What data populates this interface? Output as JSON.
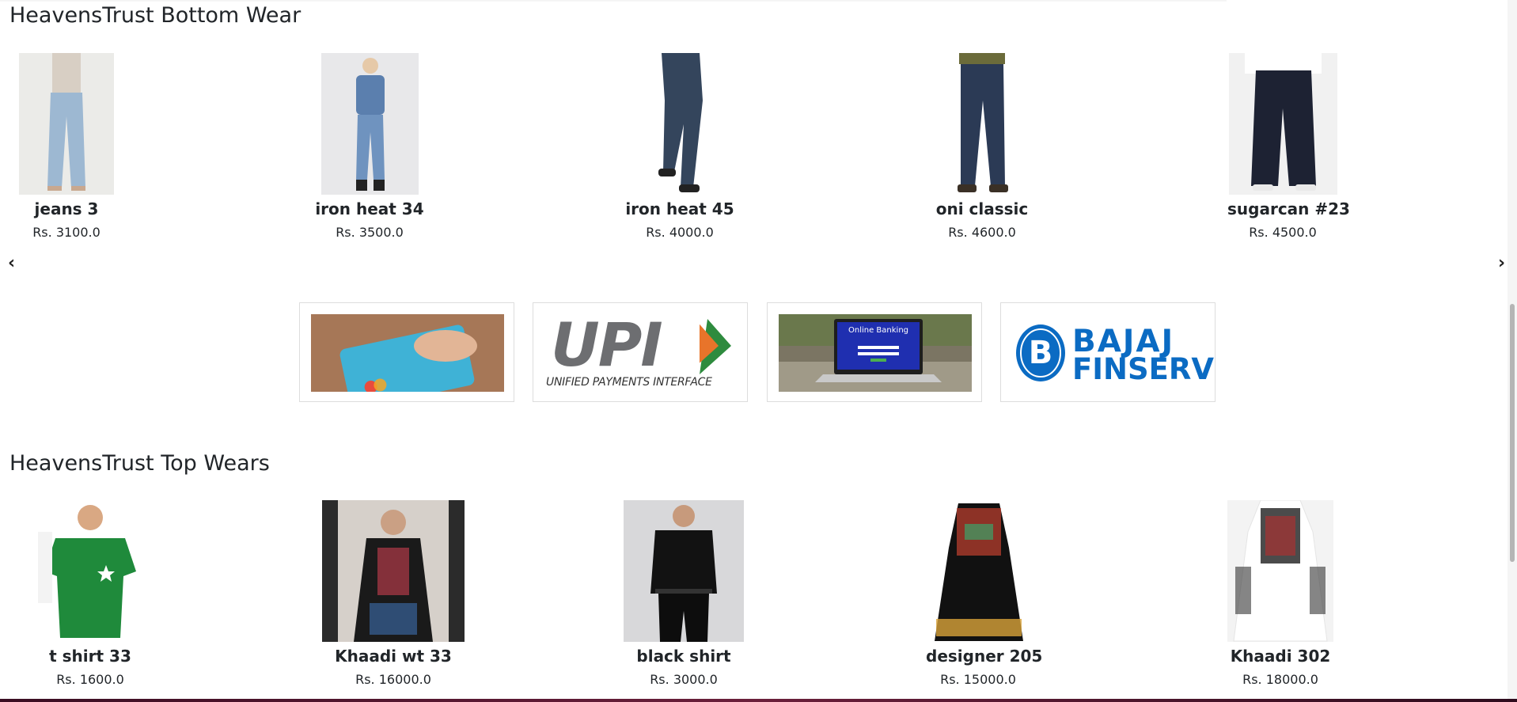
{
  "bottom_wear": {
    "title": "HeavensTrust Bottom Wear",
    "products": [
      {
        "name": "jeans 3",
        "price": "Rs. 3100.0"
      },
      {
        "name": "iron heat 34",
        "price": "Rs. 3500.0"
      },
      {
        "name": "iron heat 45",
        "price": "Rs. 4000.0"
      },
      {
        "name": "oni classic",
        "price": "Rs. 4600.0"
      },
      {
        "name": "sugarcan #23",
        "price": "Rs. 4500.0"
      }
    ]
  },
  "carousel": {
    "prev": "‹",
    "next": "›"
  },
  "payments": {
    "upi_big": "UPI",
    "upi_sub": "UNIFIED PAYMENTS INTERFACE",
    "netbanking_screen": "Online Banking",
    "bajaj_line1": "BAJAJ",
    "bajaj_line2": "FINSERV",
    "bajaj_mark": "B"
  },
  "top_wear": {
    "title": "HeavensTrust Top Wears",
    "products": [
      {
        "name": "t shirt 33",
        "price": "Rs. 1600.0"
      },
      {
        "name": "Khaadi wt 33",
        "price": "Rs. 16000.0"
      },
      {
        "name": "black shirt",
        "price": "Rs. 3000.0"
      },
      {
        "name": "designer 205",
        "price": "Rs. 15000.0"
      },
      {
        "name": "Khaadi 302",
        "price": "Rs. 18000.0"
      }
    ]
  },
  "colors": {
    "accent_blue": "#0b6bc3",
    "upi_orange": "#e8742a",
    "upi_green": "#2e8b3e"
  }
}
